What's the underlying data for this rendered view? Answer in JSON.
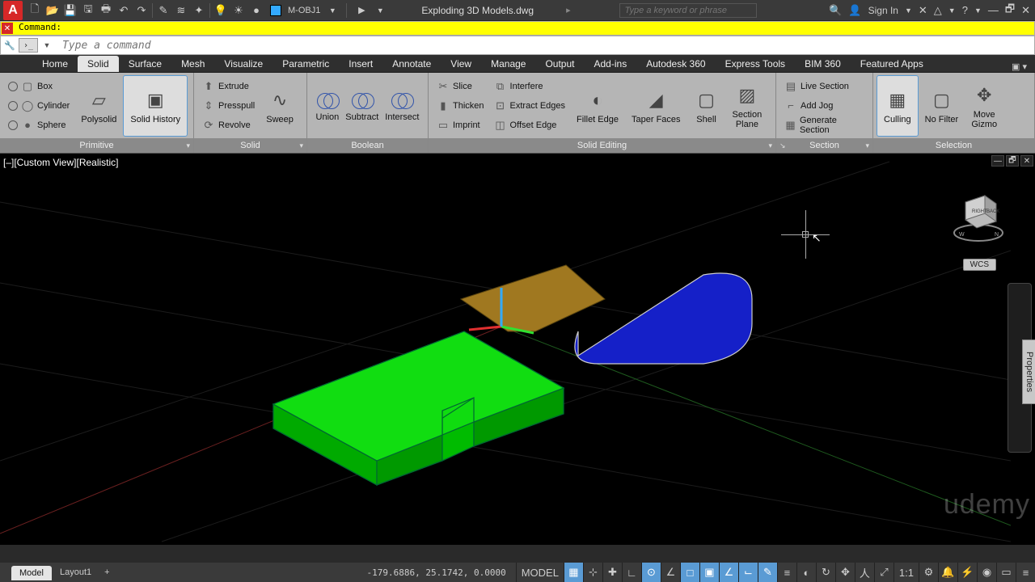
{
  "top_bar": {
    "layer_name": "M-OBJ1",
    "doc_title": "Exploding 3D Models.dwg",
    "search_placeholder": "Type a keyword or phrase",
    "signin": "Sign In"
  },
  "macro_bar": {
    "text": "Command:"
  },
  "command_line": {
    "placeholder": "Type a command"
  },
  "ribbon_tabs": {
    "items": [
      "Home",
      "Solid",
      "Surface",
      "Mesh",
      "Visualize",
      "Parametric",
      "Insert",
      "Annotate",
      "View",
      "Manage",
      "Output",
      "Add-ins",
      "Autodesk 360",
      "Express Tools",
      "BIM 360",
      "Featured Apps"
    ],
    "active_index": 1
  },
  "panels": {
    "primitive": {
      "title": "Primitive",
      "box": "Box",
      "cylinder": "Cylinder",
      "sphere": "Sphere",
      "polysolid": "Polysolid",
      "solid_history": "Solid History"
    },
    "solid": {
      "title": "Solid",
      "extrude": "Extrude",
      "presspull": "Presspull",
      "revolve": "Revolve",
      "sweep": "Sweep"
    },
    "boolean": {
      "title": "Boolean",
      "union": "Union",
      "subtract": "Subtract",
      "intersect": "Intersect"
    },
    "solid_editing": {
      "title": "Solid Editing",
      "slice": "Slice",
      "thicken": "Thicken",
      "imprint": "Imprint",
      "interfere": "Interfere",
      "extract_edges": "Extract Edges",
      "offset_edge": "Offset Edge",
      "fillet_edge": "Fillet Edge",
      "taper_faces": "Taper Faces",
      "shell": "Shell",
      "section_plane": "Section\nPlane"
    },
    "section": {
      "title": "Section",
      "live_section": "Live Section",
      "add_jog": "Add Jog",
      "generate_section": "Generate Section"
    },
    "selection": {
      "title": "Selection",
      "culling": "Culling",
      "no_filter": "No Filter",
      "move_gizmo": "Move\nGizmo"
    }
  },
  "viewport": {
    "label": "[–][Custom View][Realistic]",
    "wcs": "WCS",
    "properties_tab": "Properties"
  },
  "status_bar": {
    "model_tab": "Model",
    "layout_tab": "Layout1",
    "add_tab": "+",
    "coords": "-179.6886, 25.1742, 0.0000",
    "model_label": "MODEL",
    "scale": "1:1"
  },
  "watermark": "udemy"
}
